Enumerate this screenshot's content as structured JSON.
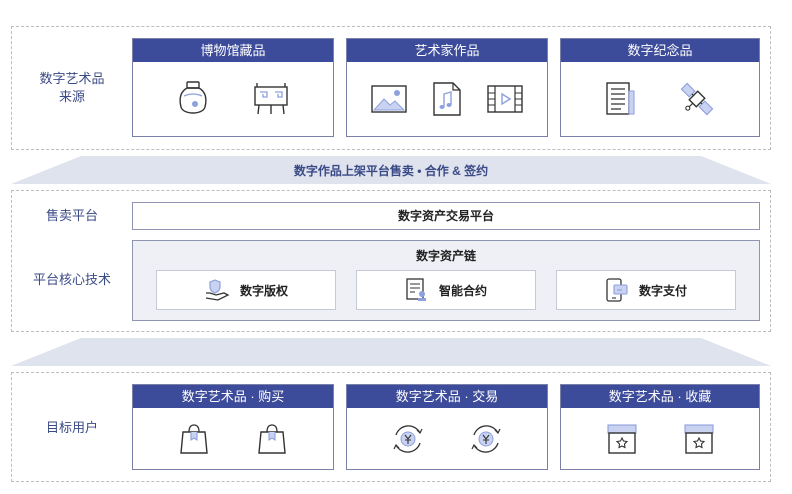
{
  "source": {
    "label_line1": "数字艺术品",
    "label_line2": "来源",
    "cards": [
      {
        "title": "博物馆藏品",
        "icons": [
          "porcelain-jar-icon",
          "bronze-ding-icon"
        ]
      },
      {
        "title": "艺术家作品",
        "icons": [
          "picture-icon",
          "music-file-icon",
          "video-film-icon"
        ]
      },
      {
        "title": "数字纪念品",
        "icons": [
          "document-icon",
          "satellite-icon"
        ]
      }
    ]
  },
  "band1": {
    "text": "数字作品上架平台售卖  •  合作 & 签约"
  },
  "platform": {
    "sale_label": "售卖平台",
    "sale_platform": "数字资产交易平台",
    "core_label": "平台核心技术",
    "chain_title": "数字资产链",
    "chain_items": [
      {
        "label": "数字版权",
        "icon": "hand-shield-icon"
      },
      {
        "label": "智能合约",
        "icon": "contract-stamp-icon"
      },
      {
        "label": "数字支付",
        "icon": "mobile-payment-icon"
      }
    ]
  },
  "users": {
    "label": "目标用户",
    "cards": [
      {
        "title": "数字艺术品 · 购买",
        "icons": [
          "shopping-bag-icon",
          "shopping-bag-icon"
        ]
      },
      {
        "title": "数字艺术品 · 交易",
        "icons": [
          "yuan-exchange-icon",
          "yuan-exchange-icon"
        ]
      },
      {
        "title": "数字艺术品 · 收藏",
        "icons": [
          "collection-box-icon",
          "collection-box-icon"
        ]
      }
    ]
  },
  "colors": {
    "header": "#3d4c9a",
    "label": "#3a4a86",
    "band": "#dfe3ee",
    "icon_accent": "#8ea0dd"
  }
}
